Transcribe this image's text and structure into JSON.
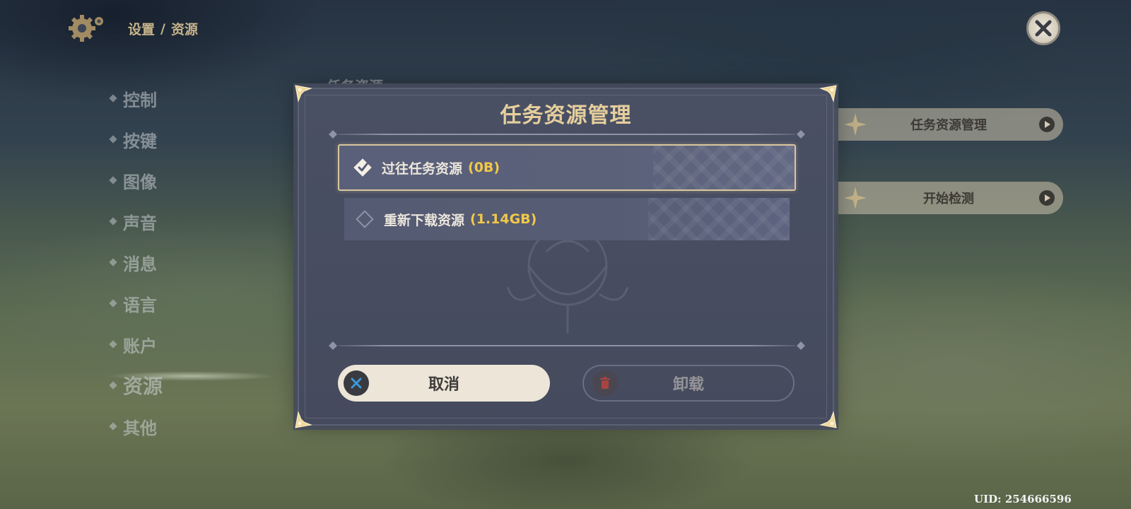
{
  "breadcrumb": {
    "parent": "设置",
    "separator": "/",
    "current": "资源"
  },
  "nav": {
    "items": [
      {
        "label": "控制"
      },
      {
        "label": "按键"
      },
      {
        "label": "图像"
      },
      {
        "label": "声音"
      },
      {
        "label": "消息"
      },
      {
        "label": "语言"
      },
      {
        "label": "账户"
      },
      {
        "label": "资源",
        "active": true
      },
      {
        "label": "其他"
      }
    ]
  },
  "background_section_label": "任务资源",
  "side_buttons": {
    "manage_label": "任务资源管理",
    "check_label": "开始检测"
  },
  "dialog": {
    "title": "任务资源管理",
    "options": [
      {
        "label": "过往任务资源",
        "size": "(0B)",
        "selected": true
      },
      {
        "label": "重新下载资源",
        "size": "(1.14GB)",
        "selected": false
      }
    ],
    "cancel_label": "取消",
    "uninstall_label": "卸载"
  },
  "uid": "UID: 254666596",
  "colors": {
    "accent_gold": "#e6cf9c",
    "size_yellow": "#f2c84b",
    "cancel_icon_blue": "#3b97d9",
    "uninstall_icon_red": "#a8443f"
  },
  "icons": {
    "settings": "gear-icon",
    "close": "close-icon",
    "cancel": "x-circle-icon",
    "uninstall": "trash-icon",
    "checkbox_checked": "checked-diamond-icon",
    "checkbox_empty": "empty-diamond-icon"
  }
}
